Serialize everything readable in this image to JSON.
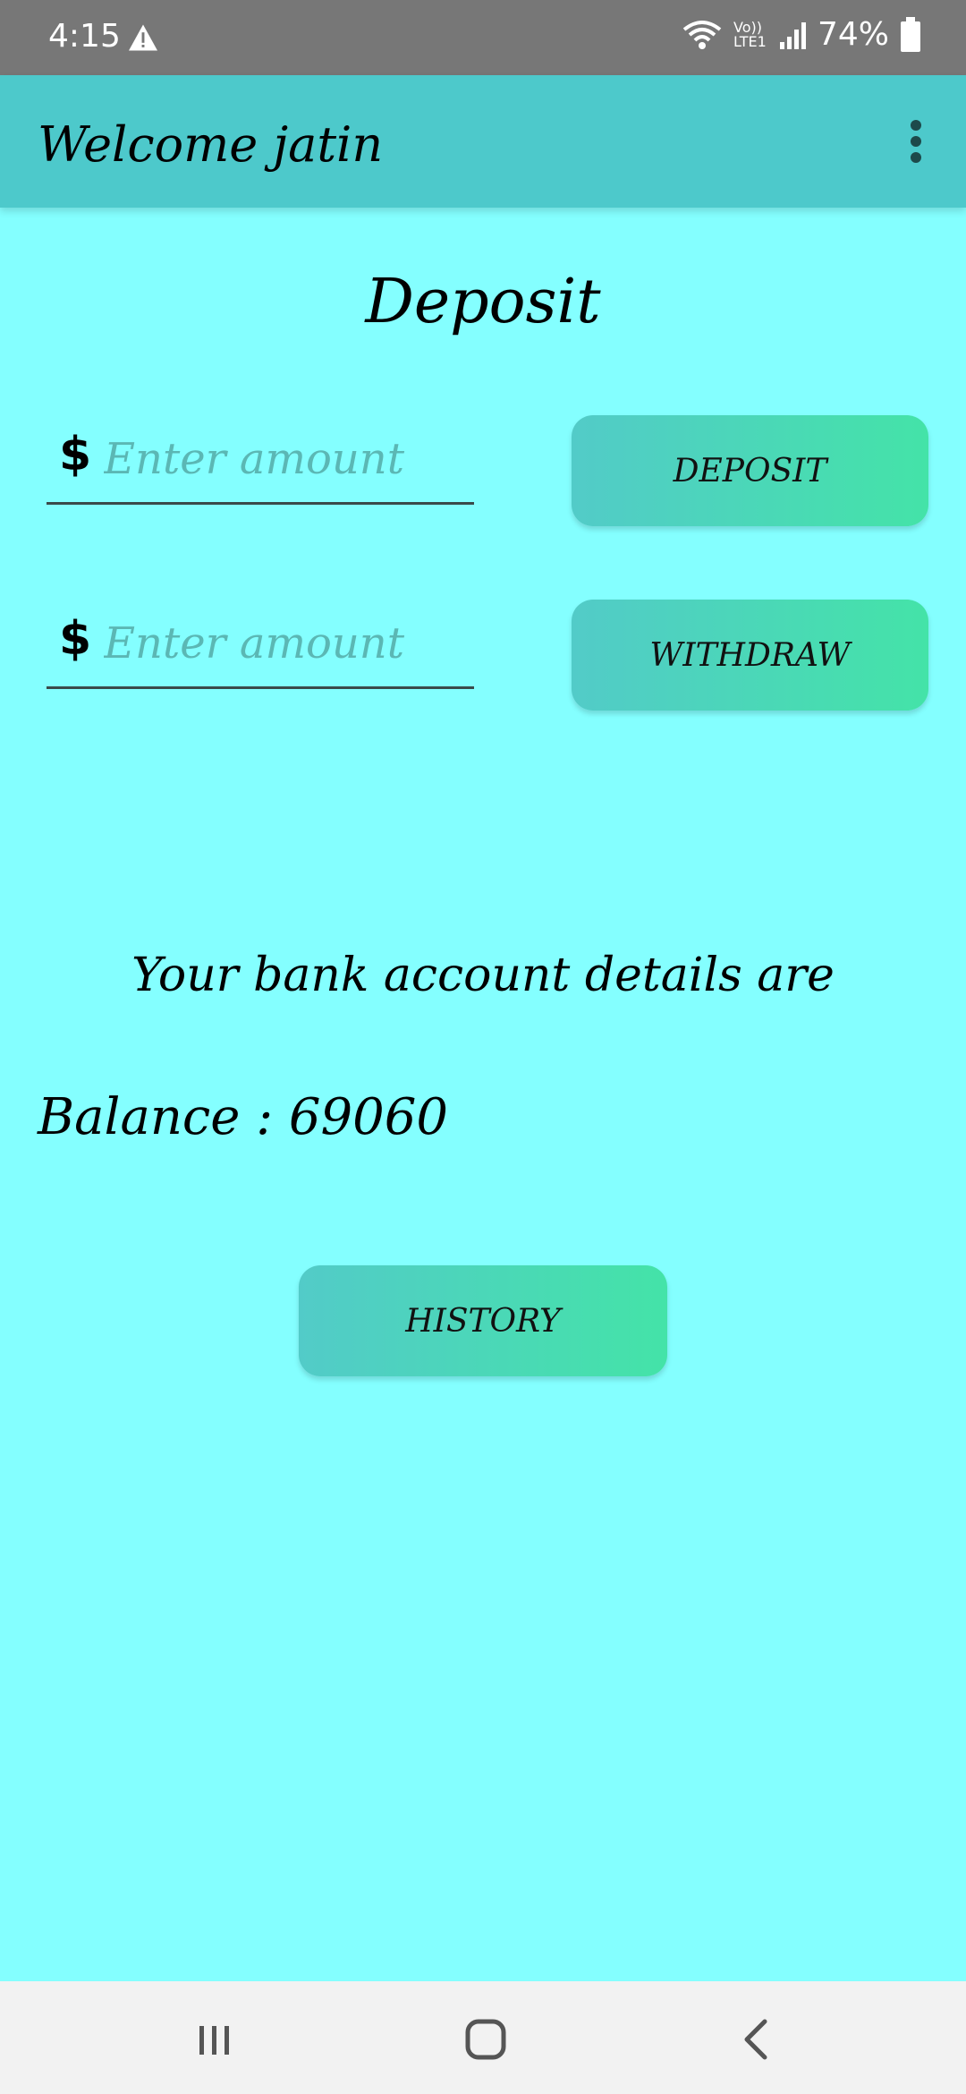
{
  "status_bar": {
    "time": "4:15",
    "network_label": "Vo)) LTE1",
    "battery": "74%"
  },
  "app_bar": {
    "title": "Welcome jatin"
  },
  "page": {
    "title": "Deposit"
  },
  "forms": {
    "deposit": {
      "currency_symbol": "$",
      "placeholder": "Enter amount",
      "button_label": "DEPOSIT"
    },
    "withdraw": {
      "currency_symbol": "$",
      "placeholder": "Enter amount",
      "button_label": "WITHDRAW"
    }
  },
  "details": {
    "heading": "Your bank account details are",
    "balance": "Balance : 69060"
  },
  "history": {
    "button_label": "HISTORY"
  },
  "icons": {
    "warning": "warning-icon",
    "wifi": "wifi-icon",
    "signal": "signal-icon",
    "battery": "battery-icon",
    "menu": "more-vert-icon",
    "nav_recents": "recents-icon",
    "nav_home": "home-icon",
    "nav_back": "back-icon"
  },
  "colors": {
    "background": "#84ffff",
    "app_bar": "#4dc9cb",
    "button_gradient_start": "#52cbc8",
    "button_gradient_end": "#44e3a8"
  }
}
